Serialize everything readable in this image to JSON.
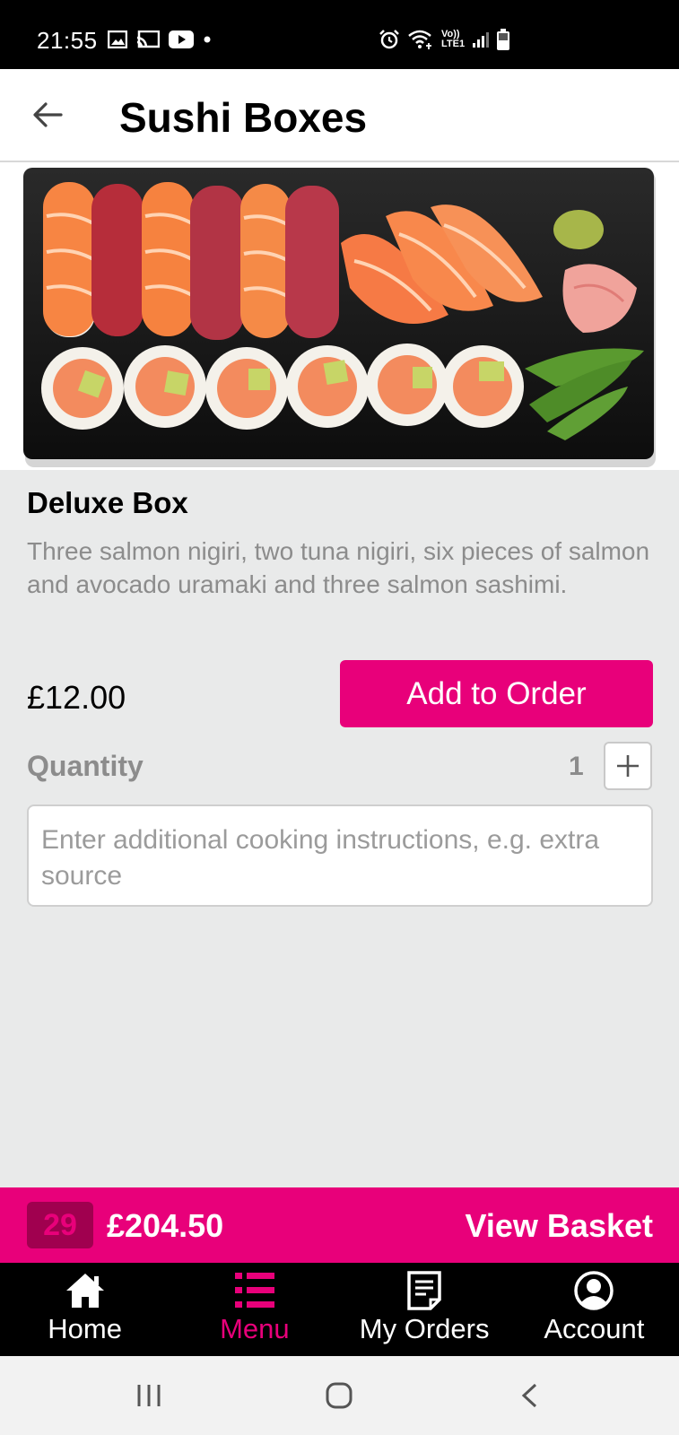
{
  "status_bar": {
    "time": "21:55",
    "icons_left": [
      "image-icon",
      "cast-icon",
      "youtube-icon",
      "dot-icon"
    ],
    "icons_right": [
      "alarm-icon",
      "wifi-icon",
      "volte-icon",
      "signal-icon",
      "battery-icon"
    ],
    "volte_text_top": "Vo))",
    "volte_text_bottom": "LTE1"
  },
  "header": {
    "title": "Sushi Boxes",
    "back_icon": "arrow-left-icon"
  },
  "product": {
    "image_alt": "sushi-box-image",
    "name": "Deluxe Box",
    "description": "Three salmon nigiri, two tuna nigiri, six pieces of salmon and avocado uramaki and three salmon sashimi.",
    "price": "£12.00",
    "add_button_label": "Add to Order",
    "quantity_label": "Quantity",
    "quantity_value": "1",
    "instructions_placeholder": "Enter additional cooking instructions, e.g. extra source",
    "instructions_value": ""
  },
  "basket": {
    "count": "29",
    "total": "£204.50",
    "view_label": "View Basket"
  },
  "bottom_nav": {
    "items": [
      {
        "label": "Home",
        "icon": "home-icon",
        "active": false
      },
      {
        "label": "Menu",
        "icon": "menu-list-icon",
        "active": true
      },
      {
        "label": "My Orders",
        "icon": "orders-document-icon",
        "active": false
      },
      {
        "label": "Account",
        "icon": "account-user-icon",
        "active": false
      }
    ]
  },
  "colors": {
    "accent": "#e8007a",
    "accent_dark": "#a0004f",
    "background": "#e9eaea",
    "muted_text": "#8c8c8c"
  }
}
